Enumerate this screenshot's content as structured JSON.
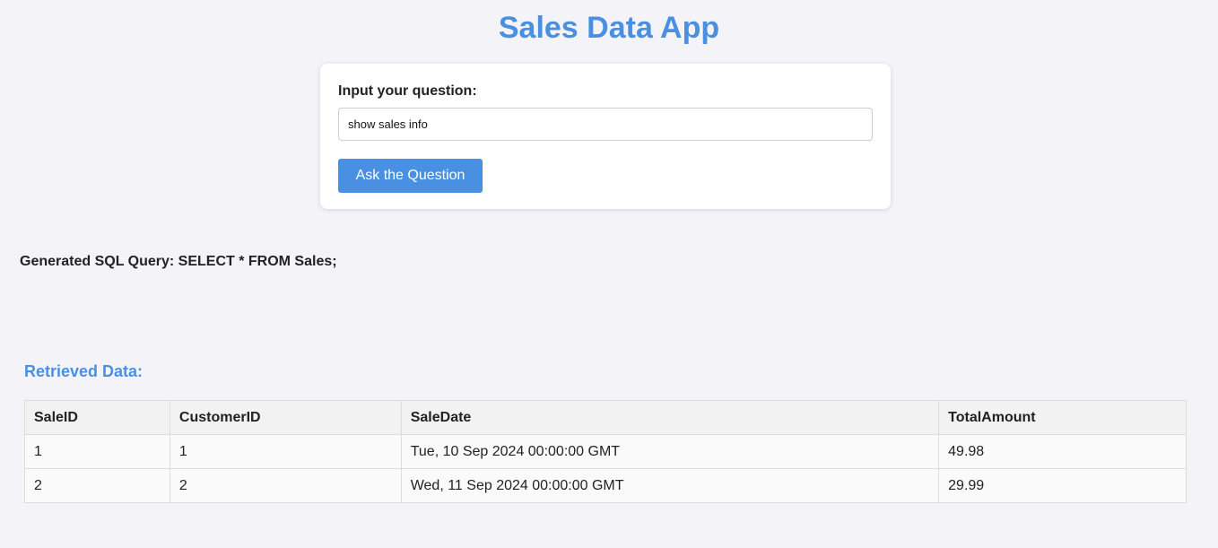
{
  "app": {
    "title": "Sales Data App"
  },
  "form": {
    "label": "Input your question:",
    "input_value": "show sales info",
    "button_label": "Ask the Question"
  },
  "query": {
    "text": "Generated SQL Query: SELECT * FROM Sales;"
  },
  "results": {
    "heading": "Retrieved Data:",
    "columns": [
      "SaleID",
      "CustomerID",
      "SaleDate",
      "TotalAmount"
    ],
    "rows": [
      [
        "1",
        "1",
        "Tue, 10 Sep 2024 00:00:00 GMT",
        "49.98"
      ],
      [
        "2",
        "2",
        "Wed, 11 Sep 2024 00:00:00 GMT",
        "29.99"
      ]
    ]
  },
  "colors": {
    "accent": "#4a90e2",
    "background": "#f4f4f8"
  }
}
